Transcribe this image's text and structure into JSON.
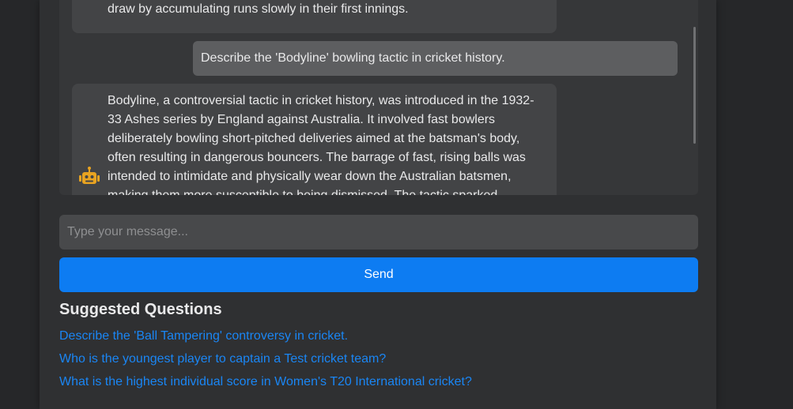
{
  "chat": {
    "messages": [
      {
        "role": "bot",
        "text": "encourage positive and attacking cricket, preventing teams from playing for a draw by accumulating runs slowly in their first innings."
      },
      {
        "role": "user",
        "text": "Describe the 'Bodyline' bowling tactic in cricket history."
      },
      {
        "role": "bot",
        "text": "Bodyline, a controversial tactic in cricket history, was introduced in the 1932-33 Ashes series by England against Australia. It involved fast bowlers deliberately bowling short-pitched deliveries aimed at the batsman's body, often resulting in dangerous bouncers. The barrage of fast, rising balls was intended to intimidate and physically wear down the Australian batsmen, making them more susceptible to being dismissed. The tactic sparked"
      }
    ],
    "bot_icon": "robot-icon"
  },
  "composer": {
    "placeholder": "Type your message...",
    "send_label": "Send"
  },
  "suggestions": {
    "title": "Suggested Questions",
    "items": [
      "Describe the 'Ball Tampering' controversy in cricket.",
      "Who is the youngest player to captain a Test cricket team?",
      "What is the highest individual score in Women's T20 International cricket?"
    ]
  },
  "colors": {
    "accent": "#0d7cf2",
    "link": "#1a86f5",
    "robot": "#e8a321"
  }
}
